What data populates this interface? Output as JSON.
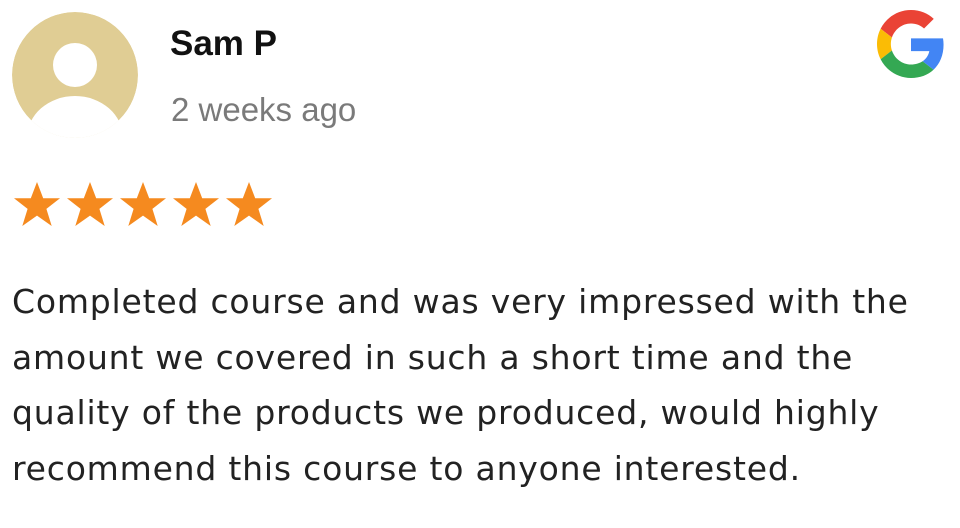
{
  "review": {
    "reviewer_name": "Sam P",
    "date": "2 weeks ago",
    "rating": 5,
    "rating_max": 5,
    "text": "Completed course and was very impressed with the amount we covered in such a short time and the quality of the products we produced, would highly recommend this course to anyone interested."
  },
  "icons": {
    "avatar": "user-avatar-icon",
    "source": "google-g-icon",
    "star": "star-icon"
  },
  "colors": {
    "avatar_background": "#e0cd94",
    "star": "#f58a1f",
    "name": "#111111",
    "date": "#7a7a7a",
    "body_text": "#222222",
    "google_blue": "#4285F4",
    "google_red": "#EA4335",
    "google_yellow": "#FBBC05",
    "google_green": "#34A853"
  }
}
